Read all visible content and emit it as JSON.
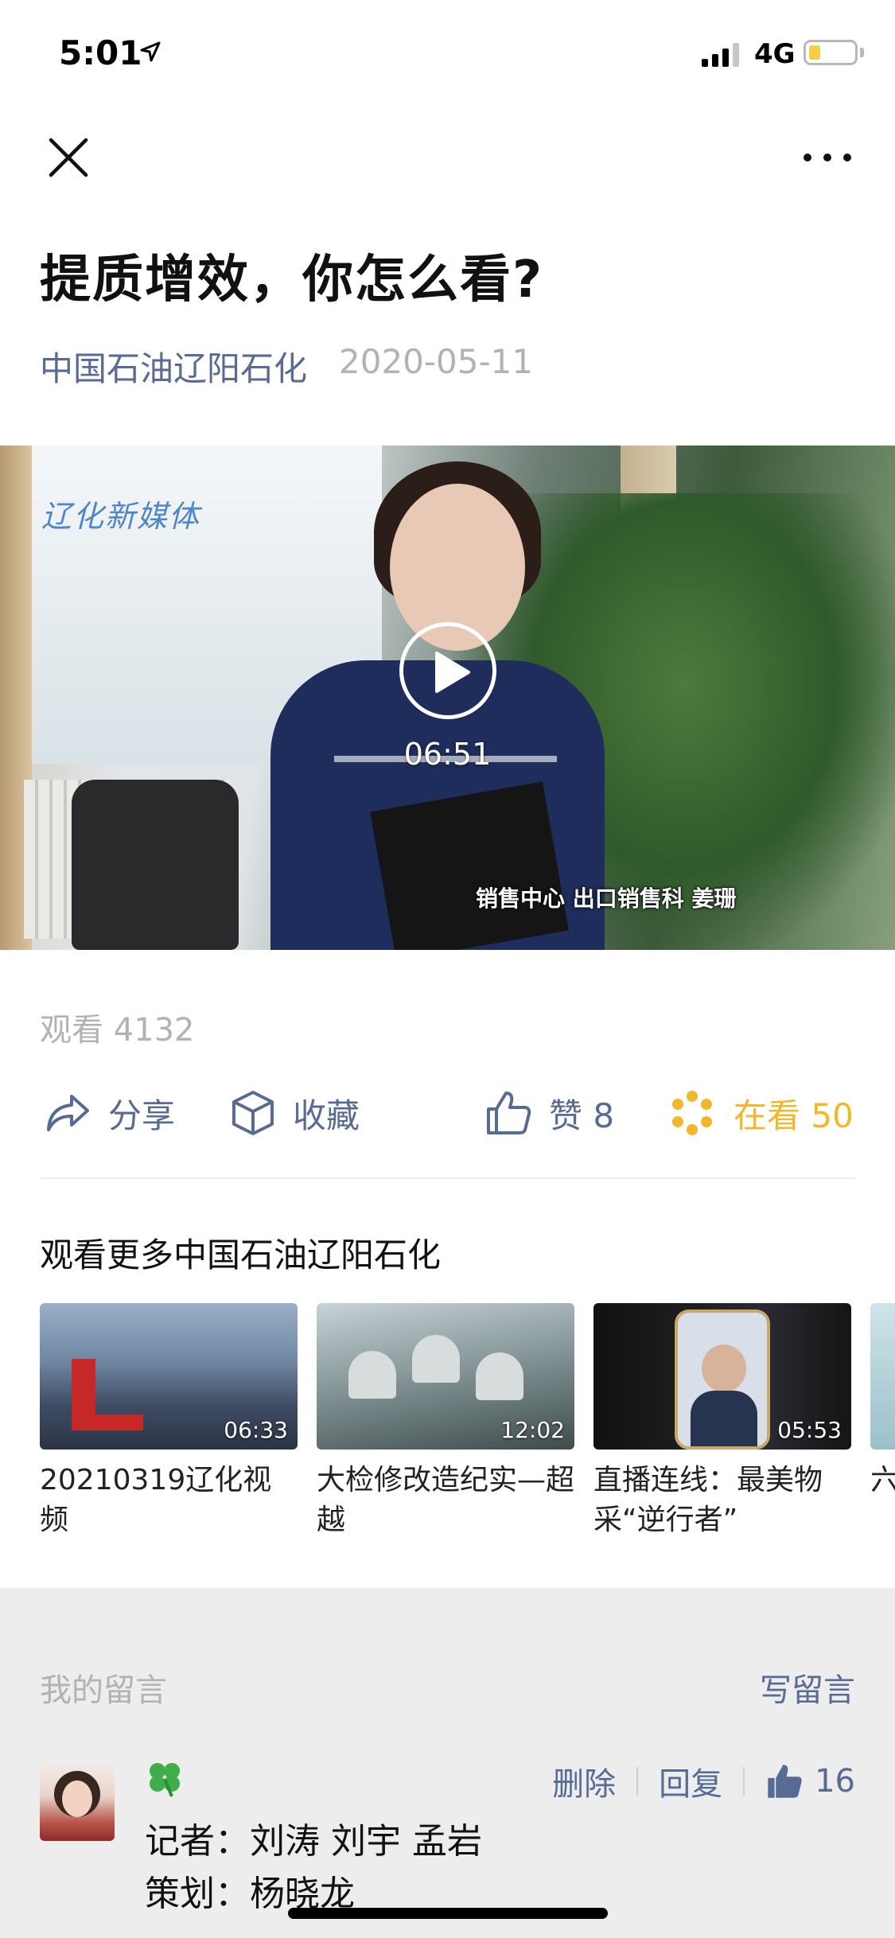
{
  "status_bar": {
    "time": "5:01",
    "network": "4G",
    "battery_color": "#f7ce46"
  },
  "nav": {
    "close_icon": "close-icon",
    "more_icon": "more-dots-icon"
  },
  "article": {
    "title": "提质增效，你怎么看?",
    "account": "中国石油辽阳石化",
    "date": "2020-05-11"
  },
  "video": {
    "watermark": "辽化新媒体",
    "caption": "销售中心 出口销售科 姜珊",
    "duration": "06:51"
  },
  "stats": {
    "views_label": "观看 4132"
  },
  "actions": {
    "share": "分享",
    "favorite": "收藏",
    "like": "赞 8",
    "watching": "在看 50",
    "watching_color": "#f3b72b",
    "link_color": "#576b95"
  },
  "more_videos": {
    "title": "观看更多中国石油辽阳石化",
    "items": [
      {
        "title": "20210319辽化视频",
        "duration": "06:33"
      },
      {
        "title": "大检修改造纪实—超越",
        "duration": "12:02"
      },
      {
        "title": "直播连线：最美物采“逆行者”",
        "duration": "05:53"
      },
      {
        "title": "六",
        "duration": ""
      }
    ]
  },
  "comments": {
    "section_label": "我的留言",
    "write_label": "写留言",
    "entry": {
      "emoji": "🍀",
      "delete_label": "删除",
      "reply_label": "回复",
      "likes": "16",
      "line1": "记者：刘涛 刘宇 孟岩",
      "line2": "策划：杨晓龙"
    }
  }
}
